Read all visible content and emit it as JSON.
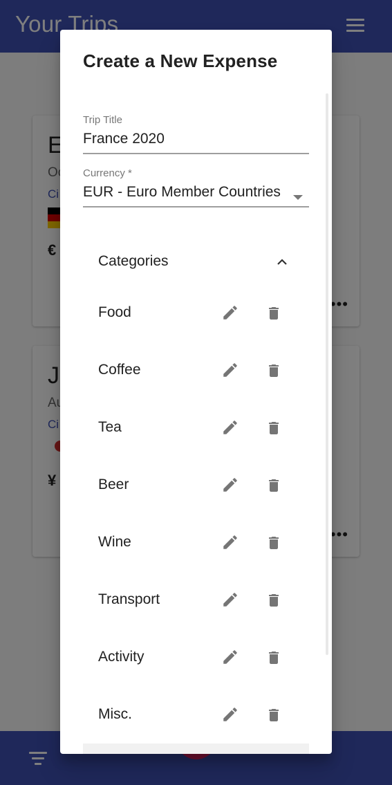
{
  "app": {
    "title": "Your Trips"
  },
  "background_cards": [
    {
      "letter": "E",
      "sub": "Oc",
      "link": "Ci",
      "currency_symbol": "€"
    },
    {
      "letter": "J",
      "sub": "Au",
      "link": "Ci",
      "currency_symbol": "¥"
    }
  ],
  "dialog": {
    "title": "Create a New Expense",
    "trip_title": {
      "label": "Trip Title",
      "value": "France 2020"
    },
    "currency": {
      "label": "Currency *",
      "value": "EUR - Euro Member Countries"
    },
    "categories": {
      "header": "Categories",
      "items": [
        {
          "label": "Food"
        },
        {
          "label": "Coffee"
        },
        {
          "label": "Tea"
        },
        {
          "label": "Beer"
        },
        {
          "label": "Wine"
        },
        {
          "label": "Transport"
        },
        {
          "label": "Activity"
        },
        {
          "label": "Misc."
        }
      ]
    }
  },
  "colors": {
    "primary": "#3f51b5",
    "accent": "#e91e63",
    "icon_gray": "#757575"
  }
}
